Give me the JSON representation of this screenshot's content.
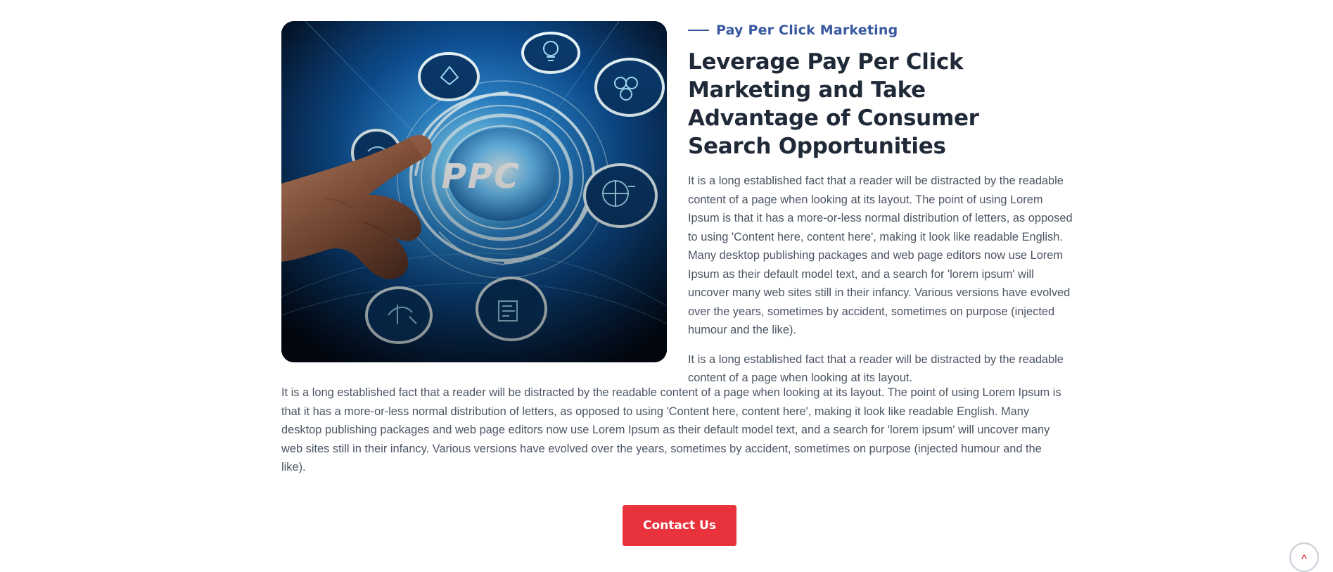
{
  "section": {
    "eyebrow": "Pay Per Click Marketing",
    "title": "Leverage Pay Per Click Marketing and Take Advantage of Consumer Search Opportunities",
    "paragraph_1": "It is a long established fact that a reader will be distracted by the readable content of a page when looking at its layout. The point of using Lorem Ipsum is that it has a more-or-less normal distribution of letters, as opposed to using 'Content here, content here', making it look like readable English. Many desktop publishing packages and web page editors now use Lorem Ipsum as their default model text, and a search for 'lorem ipsum' will uncover many web sites still in their infancy. Various versions have evolved over the years, sometimes by accident, sometimes on purpose (injected humour and the like).",
    "paragraph_2": "It is a long established fact that a reader will be distracted by the readable content of a page when looking at its layout.",
    "paragraph_3": "It is a long established fact that a reader will be distracted by the readable content of a page when looking at its layout. The point of using Lorem Ipsum is that it has a more-or-less normal distribution of letters, as opposed to using 'Content here, content here', making it look like readable English. Many desktop publishing packages and web page editors now use Lorem Ipsum as their default model text, and a search for 'lorem ipsum' will uncover many web sites still in their infancy. Various versions have evolved over the years, sometimes by accident, sometimes on purpose (injected humour and the like).",
    "button_label": "Contact Us"
  },
  "image": {
    "text": "PPC",
    "icon": "ppc-hologram-illustration"
  },
  "scroll_top": {
    "icon": "chevron-up-icon",
    "glyph": "^"
  },
  "colors": {
    "accent": "#3858a0",
    "button": "#e8333d",
    "heading": "#1f2937",
    "body_text": "#4b5563"
  }
}
